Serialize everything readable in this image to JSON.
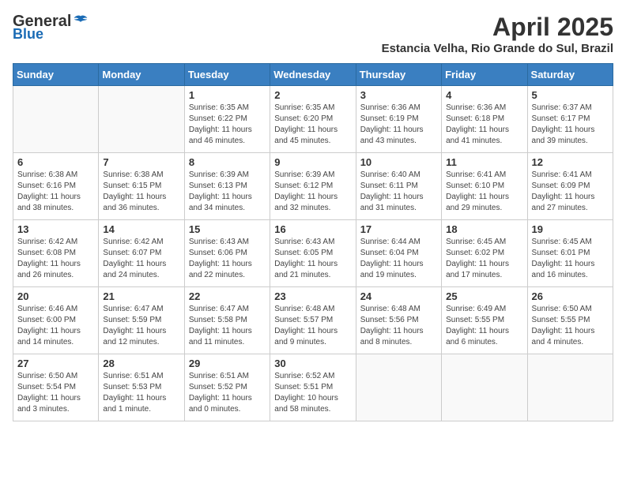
{
  "header": {
    "logo_general": "General",
    "logo_blue": "Blue",
    "month_title": "April 2025",
    "subtitle": "Estancia Velha, Rio Grande do Sul, Brazil"
  },
  "weekdays": [
    "Sunday",
    "Monday",
    "Tuesday",
    "Wednesday",
    "Thursday",
    "Friday",
    "Saturday"
  ],
  "weeks": [
    [
      {
        "day": "",
        "info": ""
      },
      {
        "day": "",
        "info": ""
      },
      {
        "day": "1",
        "info": "Sunrise: 6:35 AM\nSunset: 6:22 PM\nDaylight: 11 hours and 46 minutes."
      },
      {
        "day": "2",
        "info": "Sunrise: 6:35 AM\nSunset: 6:20 PM\nDaylight: 11 hours and 45 minutes."
      },
      {
        "day": "3",
        "info": "Sunrise: 6:36 AM\nSunset: 6:19 PM\nDaylight: 11 hours and 43 minutes."
      },
      {
        "day": "4",
        "info": "Sunrise: 6:36 AM\nSunset: 6:18 PM\nDaylight: 11 hours and 41 minutes."
      },
      {
        "day": "5",
        "info": "Sunrise: 6:37 AM\nSunset: 6:17 PM\nDaylight: 11 hours and 39 minutes."
      }
    ],
    [
      {
        "day": "6",
        "info": "Sunrise: 6:38 AM\nSunset: 6:16 PM\nDaylight: 11 hours and 38 minutes."
      },
      {
        "day": "7",
        "info": "Sunrise: 6:38 AM\nSunset: 6:15 PM\nDaylight: 11 hours and 36 minutes."
      },
      {
        "day": "8",
        "info": "Sunrise: 6:39 AM\nSunset: 6:13 PM\nDaylight: 11 hours and 34 minutes."
      },
      {
        "day": "9",
        "info": "Sunrise: 6:39 AM\nSunset: 6:12 PM\nDaylight: 11 hours and 32 minutes."
      },
      {
        "day": "10",
        "info": "Sunrise: 6:40 AM\nSunset: 6:11 PM\nDaylight: 11 hours and 31 minutes."
      },
      {
        "day": "11",
        "info": "Sunrise: 6:41 AM\nSunset: 6:10 PM\nDaylight: 11 hours and 29 minutes."
      },
      {
        "day": "12",
        "info": "Sunrise: 6:41 AM\nSunset: 6:09 PM\nDaylight: 11 hours and 27 minutes."
      }
    ],
    [
      {
        "day": "13",
        "info": "Sunrise: 6:42 AM\nSunset: 6:08 PM\nDaylight: 11 hours and 26 minutes."
      },
      {
        "day": "14",
        "info": "Sunrise: 6:42 AM\nSunset: 6:07 PM\nDaylight: 11 hours and 24 minutes."
      },
      {
        "day": "15",
        "info": "Sunrise: 6:43 AM\nSunset: 6:06 PM\nDaylight: 11 hours and 22 minutes."
      },
      {
        "day": "16",
        "info": "Sunrise: 6:43 AM\nSunset: 6:05 PM\nDaylight: 11 hours and 21 minutes."
      },
      {
        "day": "17",
        "info": "Sunrise: 6:44 AM\nSunset: 6:04 PM\nDaylight: 11 hours and 19 minutes."
      },
      {
        "day": "18",
        "info": "Sunrise: 6:45 AM\nSunset: 6:02 PM\nDaylight: 11 hours and 17 minutes."
      },
      {
        "day": "19",
        "info": "Sunrise: 6:45 AM\nSunset: 6:01 PM\nDaylight: 11 hours and 16 minutes."
      }
    ],
    [
      {
        "day": "20",
        "info": "Sunrise: 6:46 AM\nSunset: 6:00 PM\nDaylight: 11 hours and 14 minutes."
      },
      {
        "day": "21",
        "info": "Sunrise: 6:47 AM\nSunset: 5:59 PM\nDaylight: 11 hours and 12 minutes."
      },
      {
        "day": "22",
        "info": "Sunrise: 6:47 AM\nSunset: 5:58 PM\nDaylight: 11 hours and 11 minutes."
      },
      {
        "day": "23",
        "info": "Sunrise: 6:48 AM\nSunset: 5:57 PM\nDaylight: 11 hours and 9 minutes."
      },
      {
        "day": "24",
        "info": "Sunrise: 6:48 AM\nSunset: 5:56 PM\nDaylight: 11 hours and 8 minutes."
      },
      {
        "day": "25",
        "info": "Sunrise: 6:49 AM\nSunset: 5:55 PM\nDaylight: 11 hours and 6 minutes."
      },
      {
        "day": "26",
        "info": "Sunrise: 6:50 AM\nSunset: 5:55 PM\nDaylight: 11 hours and 4 minutes."
      }
    ],
    [
      {
        "day": "27",
        "info": "Sunrise: 6:50 AM\nSunset: 5:54 PM\nDaylight: 11 hours and 3 minutes."
      },
      {
        "day": "28",
        "info": "Sunrise: 6:51 AM\nSunset: 5:53 PM\nDaylight: 11 hours and 1 minute."
      },
      {
        "day": "29",
        "info": "Sunrise: 6:51 AM\nSunset: 5:52 PM\nDaylight: 11 hours and 0 minutes."
      },
      {
        "day": "30",
        "info": "Sunrise: 6:52 AM\nSunset: 5:51 PM\nDaylight: 10 hours and 58 minutes."
      },
      {
        "day": "",
        "info": ""
      },
      {
        "day": "",
        "info": ""
      },
      {
        "day": "",
        "info": ""
      }
    ]
  ]
}
